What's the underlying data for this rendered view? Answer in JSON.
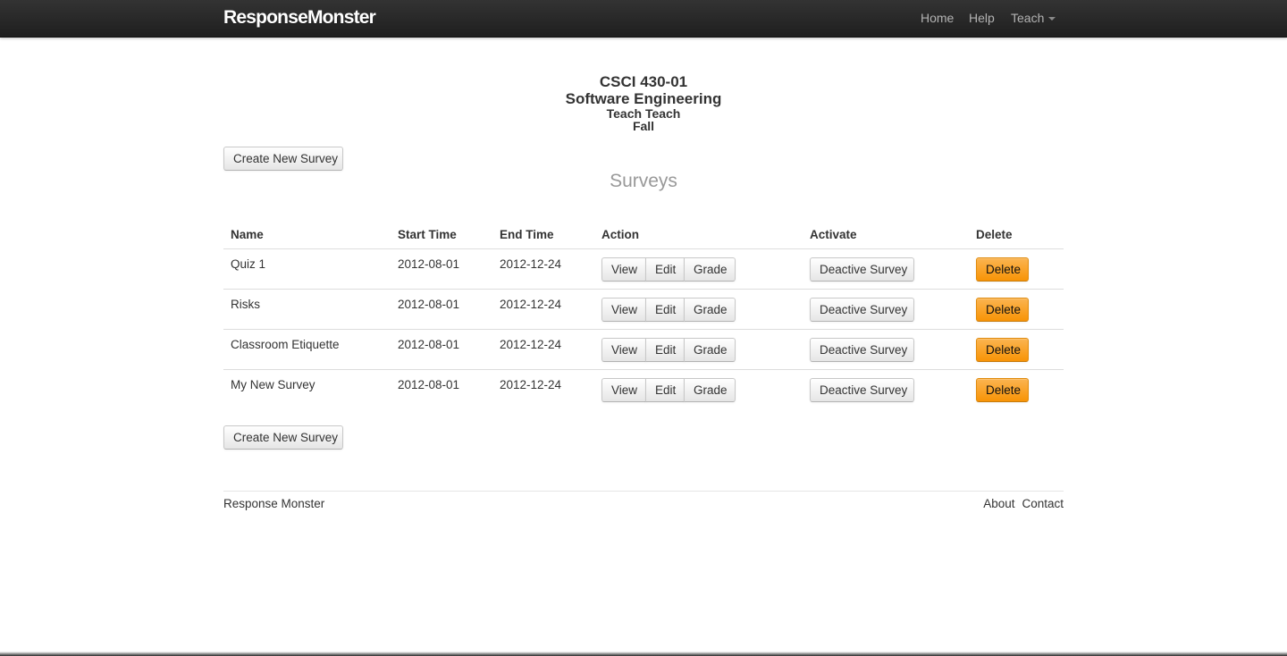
{
  "navbar": {
    "brand": "ResponseMonster",
    "items": [
      {
        "label": "Home"
      },
      {
        "label": "Help"
      },
      {
        "label": "Teach"
      }
    ]
  },
  "course": {
    "code": "CSCI 430-01",
    "name": "Software Engineering",
    "teacher": "Teach Teach",
    "term": "Fall"
  },
  "actions": {
    "create_survey_label": "Create New Survey"
  },
  "surveys": {
    "title": "Surveys",
    "columns": [
      "Name",
      "Start Time",
      "End Time",
      "Action",
      "Activate",
      "Delete"
    ],
    "rows": [
      {
        "name": "Quiz 1",
        "start": "2012-08-01",
        "end": "2012-12-24",
        "view": "View",
        "edit": "Edit",
        "grade": "Grade",
        "activate": "Deactive Survey",
        "delete": "Delete"
      },
      {
        "name": "Risks",
        "start": "2012-08-01",
        "end": "2012-12-24",
        "view": "View",
        "edit": "Edit",
        "grade": "Grade",
        "activate": "Deactive Survey",
        "delete": "Delete"
      },
      {
        "name": "Classroom Etiquette",
        "start": "2012-08-01",
        "end": "2012-12-24",
        "view": "View",
        "edit": "Edit",
        "grade": "Grade",
        "activate": "Deactive Survey",
        "delete": "Delete"
      },
      {
        "name": "My New Survey",
        "start": "2012-08-01",
        "end": "2012-12-24",
        "view": "View",
        "edit": "Edit",
        "grade": "Grade",
        "activate": "Deactive Survey",
        "delete": "Delete"
      }
    ]
  },
  "footer": {
    "site_name": "Response Monster",
    "links": [
      {
        "label": "About"
      },
      {
        "label": "Contact"
      }
    ]
  },
  "colors": {
    "navbar_bg": "#222222",
    "delete_button": "#f89406",
    "section_title": "#999999"
  },
  "icons": {
    "teach_menu": "caret-down-icon"
  }
}
